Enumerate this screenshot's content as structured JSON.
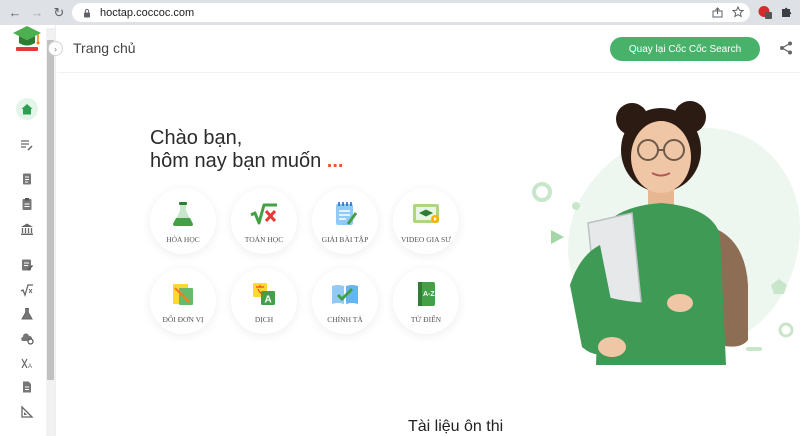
{
  "browser": {
    "url": "hoctap.coccoc.com"
  },
  "header": {
    "title": "Trang chủ",
    "back_button": "Quay lại Cốc Cốc Search"
  },
  "greeting": {
    "line1": "Chào bạn,",
    "line2": "hôm nay bạn muốn",
    "dots": "..."
  },
  "tiles": [
    {
      "label": "HÓA HỌC",
      "icon": "flask-icon"
    },
    {
      "label": "TOÁN HỌC",
      "icon": "sqrt-x-icon"
    },
    {
      "label": "GIẢI BÀI TẬP",
      "icon": "notepad-icon"
    },
    {
      "label": "VIDEO GIA SƯ",
      "icon": "video-tutor-icon"
    },
    {
      "label": "ĐỔI ĐƠN VỊ",
      "icon": "ruler-icon"
    },
    {
      "label": "DỊCH",
      "icon": "translate-icon"
    },
    {
      "label": "CHÍNH TẢ",
      "icon": "book-check-icon"
    },
    {
      "label": "TỪ ĐIỂN",
      "icon": "dictionary-icon"
    }
  ],
  "section": {
    "title": "Tài liệu ôn thi"
  },
  "colors": {
    "brand_green": "#48b26a",
    "accent_orange": "#e8582a",
    "hero_bg": "#edf7ef"
  }
}
